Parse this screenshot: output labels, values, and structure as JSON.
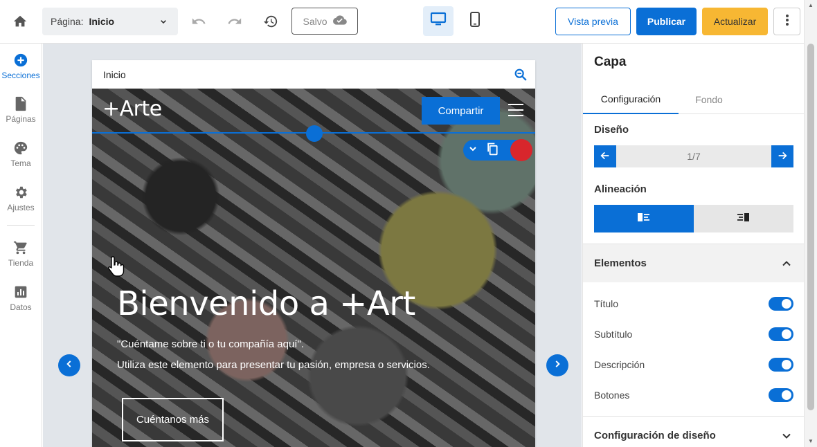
{
  "topbar": {
    "page_label": "Página:",
    "page_value": "Inicio",
    "saved_label": "Salvo",
    "preview_label": "Vista previa",
    "publish_label": "Publicar",
    "update_label": "Actualizar"
  },
  "sidebar": {
    "items": [
      {
        "label": "Secciones",
        "icon": "plus-circle-icon"
      },
      {
        "label": "Páginas",
        "icon": "page-icon"
      },
      {
        "label": "Tema",
        "icon": "palette-icon"
      },
      {
        "label": "Ajustes",
        "icon": "gear-icon"
      },
      {
        "label": "Tienda",
        "icon": "cart-icon"
      },
      {
        "label": "Datos",
        "icon": "chart-icon"
      }
    ]
  },
  "canvas": {
    "frame_title": "Inicio",
    "brand": "+Arte",
    "share_label": "Compartir",
    "hero_title": "Bienvenido a +Art",
    "hero_subtitle": "\"Cuéntame sobre ti o tu compañía aquí\".",
    "hero_description": "Utiliza este elemento para presentar tu pasión, empresa o servicios.",
    "hero_cta": "Cuéntanos más"
  },
  "panel": {
    "title": "Capa",
    "tabs": [
      "Configuración",
      "Fondo"
    ],
    "design_label": "Diseño",
    "design_pager": "1/7",
    "alignment_label": "Alineación",
    "elements_label": "Elementos",
    "toggles": [
      {
        "label": "Título",
        "on": true
      },
      {
        "label": "Subtítulo",
        "on": true
      },
      {
        "label": "Descripción",
        "on": true
      },
      {
        "label": "Botones",
        "on": true
      }
    ],
    "layout_settings_label": "Configuración de diseño"
  },
  "colors": {
    "accent": "#0a6fd6",
    "update": "#f7b733",
    "delete": "#d8262c"
  }
}
